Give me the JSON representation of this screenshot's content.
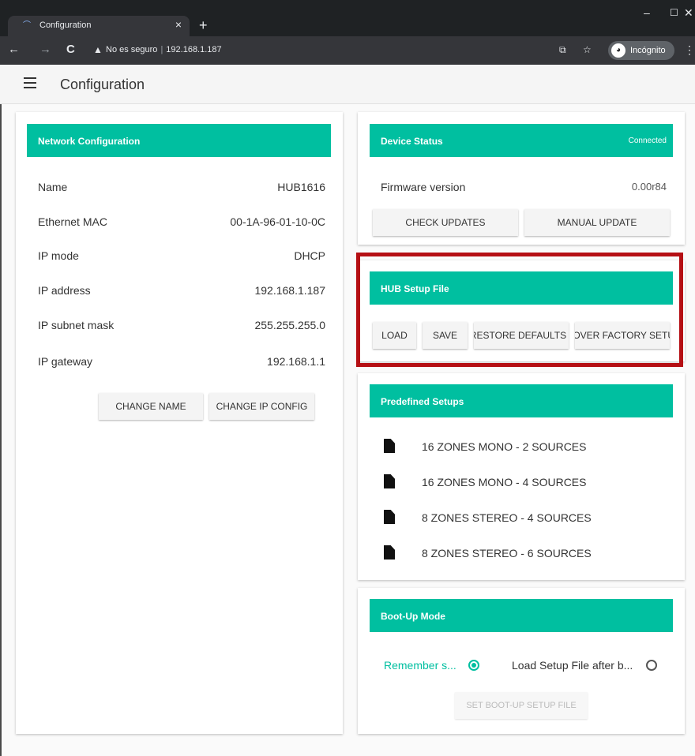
{
  "browser": {
    "tab_title": "Configuration",
    "tab_close": "×",
    "new_tab": "+",
    "win_min": "–",
    "win_max": "☐",
    "win_close": "✕",
    "back": "←",
    "forward": "→",
    "reload": "C",
    "security_text": "No es seguro",
    "url": "192.168.1.187",
    "incognito_label": "Incógnito",
    "translate_icon": "translate-icon",
    "star_icon": "star-icon"
  },
  "app": {
    "title": "Configuration"
  },
  "network": {
    "header": "Network Configuration",
    "rows": [
      {
        "label": "Name",
        "value": "HUB1616"
      },
      {
        "label": "Ethernet MAC",
        "value": "00-1A-96-01-10-0C"
      },
      {
        "label": "IP mode",
        "value": "DHCP"
      },
      {
        "label": "IP address",
        "value": "192.168.1.187"
      },
      {
        "label": "IP subnet mask",
        "value": "255.255.255.0"
      },
      {
        "label": "IP gateway",
        "value": "192.168.1.1"
      }
    ],
    "change_name": "CHANGE NAME",
    "change_ip": "CHANGE IP CONFIG"
  },
  "device_status": {
    "header": "Device Status",
    "status": "Connected",
    "firmware_label": "Firmware version",
    "firmware_value": "0.00r84",
    "check_updates": "CHECK UPDATES",
    "manual_update": "MANUAL UPDATE"
  },
  "hub_setup": {
    "header": "HUB Setup File",
    "load": "LOAD",
    "save": "SAVE",
    "restore_defaults": "RESTORE DEFAULTS",
    "recover_factory": "RECOVER FACTORY SETUP"
  },
  "predefined": {
    "header": "Predefined Setups",
    "items": [
      "16 ZONES MONO - 2 SOURCES",
      "16 ZONES MONO - 4 SOURCES",
      "8 ZONES STEREO - 4 SOURCES",
      "8 ZONES STEREO - 6 SOURCES"
    ]
  },
  "boot": {
    "header": "Boot-Up Mode",
    "option1": "Remember s...",
    "option2": "Load Setup File after b...",
    "selected": "option1",
    "set_button": "SET BOOT-UP SETUP FILE"
  },
  "colors": {
    "accent": "#00bfa0",
    "highlight": "#b50f14"
  }
}
